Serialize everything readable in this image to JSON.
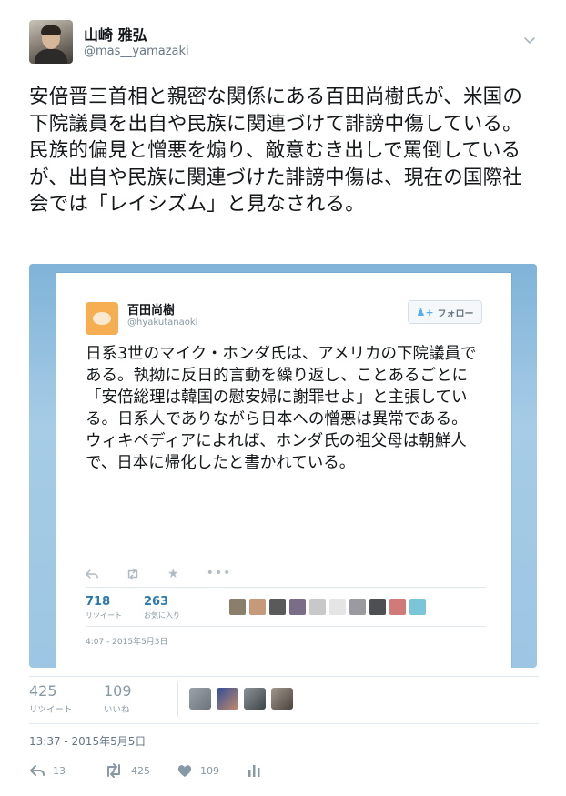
{
  "author": {
    "display_name": "山崎 雅弘",
    "handle": "@mas__yamazaki"
  },
  "tweet": {
    "text": "安倍晋三首相と親密な関係にある百田尚樹氏が、米国の下院議員を出自や民族に関連づけて誹謗中傷している。民族的偏見と憎悪を煽り、敵意むき出しで罵倒しているが、出自や民族に関連づけた誹謗中傷は、現在の国際社会では「レイシズム」と見なされる。",
    "timestamp": "13:37 - 2015年5月5日"
  },
  "embedded": {
    "display_name": "百田尚樹",
    "handle": "@hyakutanaoki",
    "follow_label": "フォロー",
    "text": "日系3世のマイク・ホンダ氏は、アメリカの下院議員である。執拗に反日的言動を繰り返し、ことあるごとに「安倍総理は韓国の慰安婦に謝罪せよ」と主張している。日系人でありながら日本への憎悪は異常である。\nウィキペディアによれば、ホンダ氏の祖父母は朝鮮人で、日本に帰化したと書かれている。",
    "retweets": "718",
    "retweets_label": "リツイート",
    "likes": "263",
    "likes_label": "お気に入り",
    "timestamp": "4:07 - 2015年5月3日",
    "icons": [
      "reply-icon",
      "retweet-icon",
      "star-icon",
      "more-icon"
    ]
  },
  "stats": {
    "retweets": "425",
    "retweets_label": "リツイート",
    "likes": "109",
    "likes_label": "いいね"
  },
  "actions": {
    "reply_count": "13",
    "retweet_count": "425",
    "like_count": "109"
  },
  "colors": {
    "accent": "#55acee",
    "text": "#14171a",
    "muted": "#8899a6"
  }
}
